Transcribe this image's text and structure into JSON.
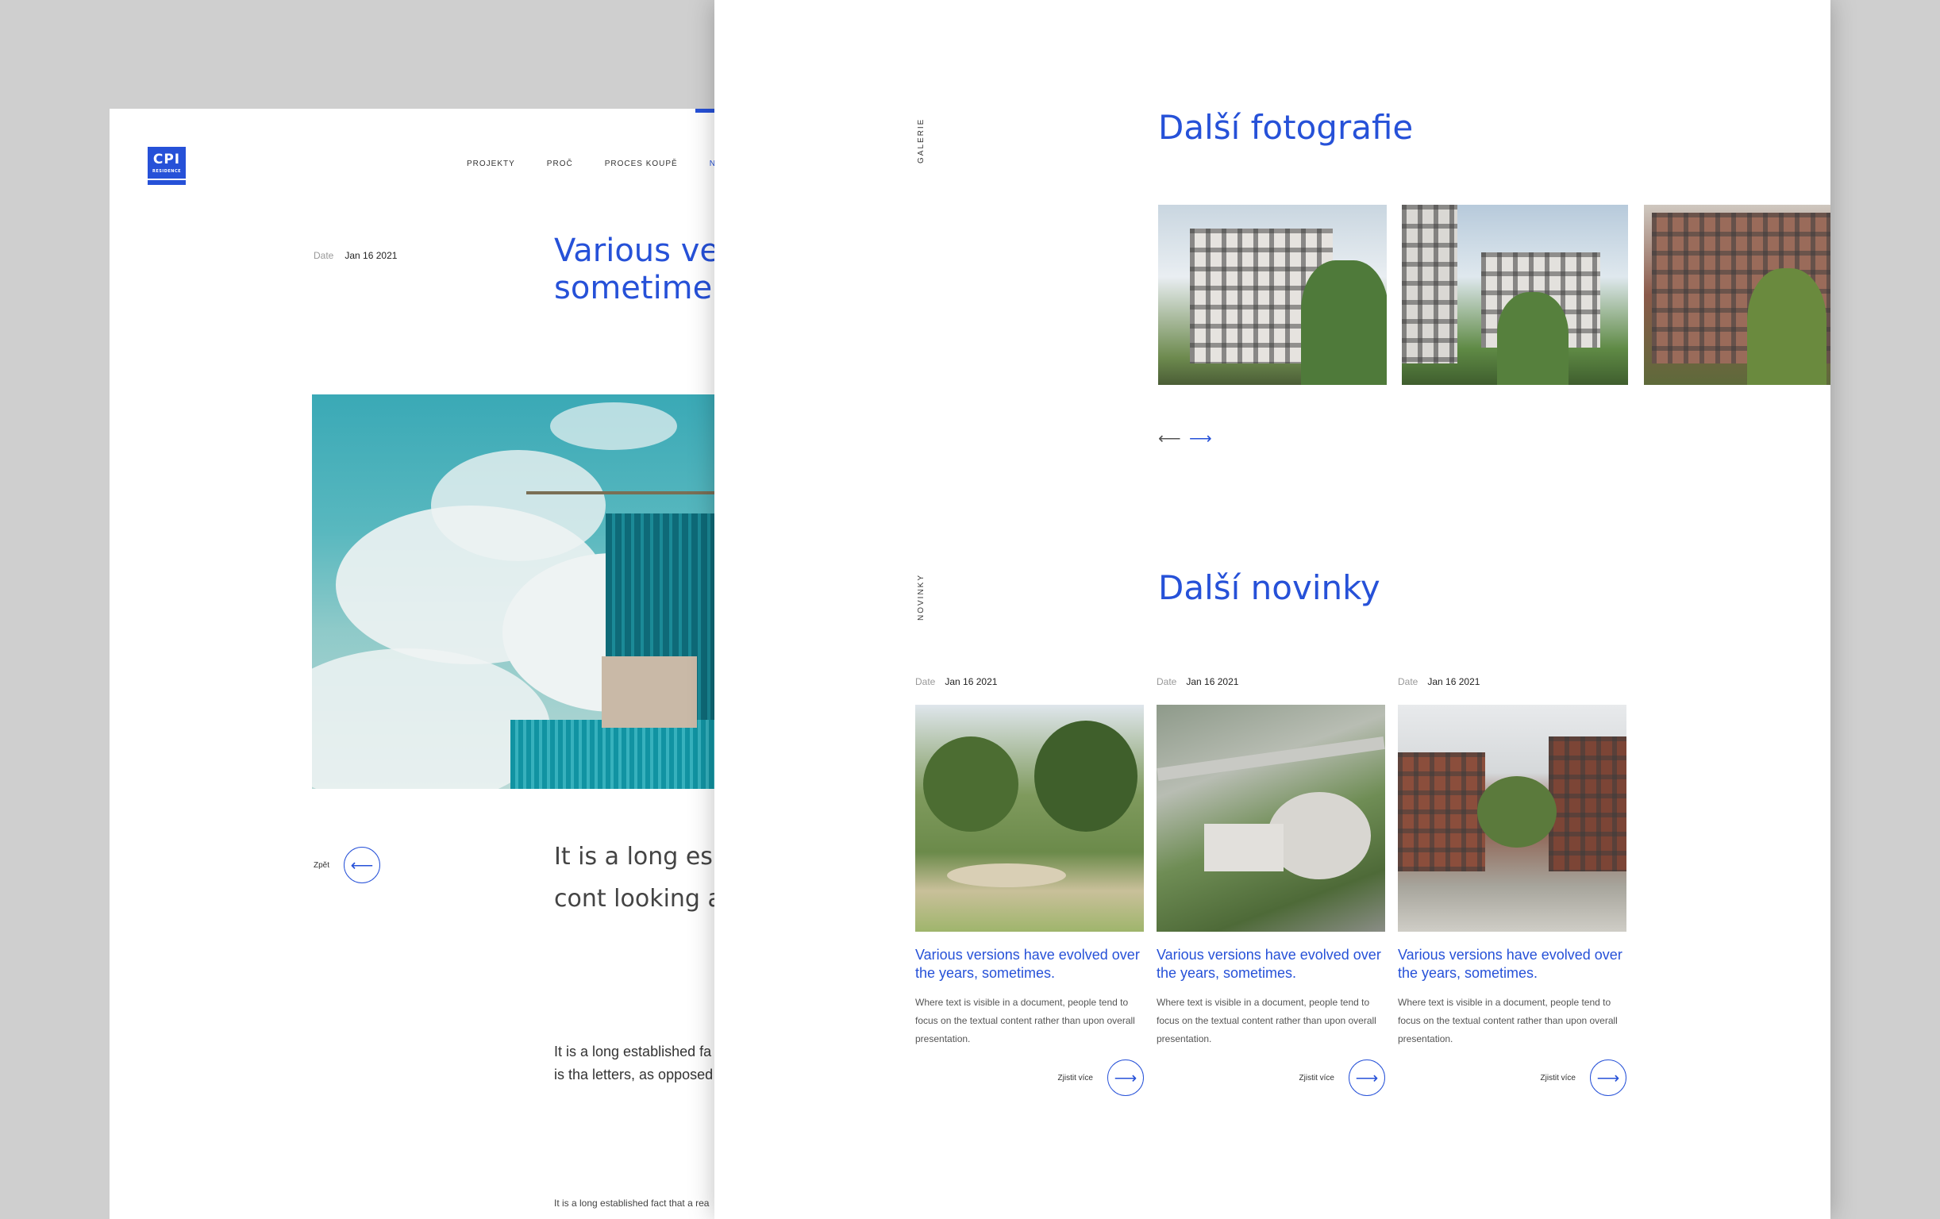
{
  "left_page": {
    "logo": {
      "top": "CPI",
      "bottom": "RESIDENCE"
    },
    "nav": [
      "PROJEKTY",
      "PROČ",
      "PROCES KOUPĚ",
      "NOV"
    ],
    "meta": {
      "label": "Date",
      "value": "Jan 16 2021"
    },
    "title": "Various ve evolved ov sometime",
    "back_label": "Zpět",
    "lead": "It is a long es reader will be readable cont looking at its",
    "body": "It is a long established fa readable content of a pa using Lorem Ipsum is tha letters, as opposed to us like readable English. Ma",
    "small_text": "It is a long established fact that a rea"
  },
  "right_page": {
    "gallery": {
      "vertical_label": "GALERIE",
      "title": "Další fotografie",
      "prev_icon": "arrow-left-icon",
      "next_icon": "arrow-right-icon"
    },
    "news": {
      "vertical_label": "NOVINKY",
      "title": "Další novinky",
      "items": [
        {
          "date_label": "Date",
          "date": "Jan 16 2021",
          "title": "Various versions have evolved over the years, sometimes.",
          "excerpt": "Where text is visible in a document, people tend to focus on the textual content rather than upon overall presentation.",
          "more": "Zjistit více"
        },
        {
          "date_label": "Date",
          "date": "Jan 16 2021",
          "title": "Various versions have evolved over the years, sometimes.",
          "excerpt": "Where text is visible in a document, people tend to focus on the textual content rather than upon overall presentation.",
          "more": "Zjistit více"
        },
        {
          "date_label": "Date",
          "date": "Jan 16 2021",
          "title": "Various versions have evolved over the years, sometimes.",
          "excerpt": "Where text is visible in a document, people tend to focus on the textual content rather than upon overall presentation.",
          "more": "Zjistit více"
        }
      ]
    }
  },
  "colors": {
    "accent": "#2651d8",
    "backdrop": "#cfcfcf"
  }
}
